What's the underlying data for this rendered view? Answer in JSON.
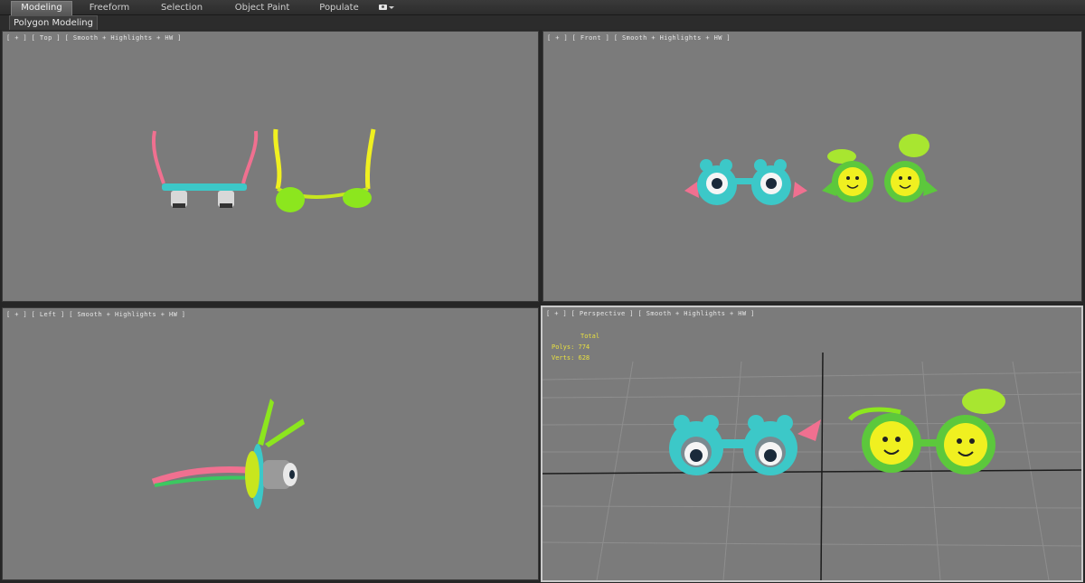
{
  "ribbon": {
    "tabs": [
      "Modeling",
      "Freeform",
      "Selection",
      "Object Paint",
      "Populate"
    ],
    "active_tab": "Modeling",
    "camera_icon": "camera-icon"
  },
  "subribbon": {
    "panel_label": "Polygon Modeling"
  },
  "viewports": {
    "top": {
      "label": "[ + ] [ Top ] [ Smooth + Highlights + HW ]"
    },
    "front": {
      "label": "[ + ] [ Front ] [ Smooth + Highlights + HW ]"
    },
    "left": {
      "label": "[ + ] [ Left ] [ Smooth + Highlights + HW ]"
    },
    "perspective": {
      "label": "[ + ] [ Perspective ] [ Smooth + Highlights + HW ]",
      "stats_total": "Total",
      "stats_polys": "Polys: 774",
      "stats_verts": "Verts: 628"
    }
  },
  "colors": {
    "viewport_bg": "#7b7b7b",
    "frog_cyan": "#3cc8c8",
    "smiley_green": "#8ce61e",
    "smiley_yellow": "#f0f020",
    "temple_pink": "#f07090",
    "stats_text": "#e8e040"
  }
}
